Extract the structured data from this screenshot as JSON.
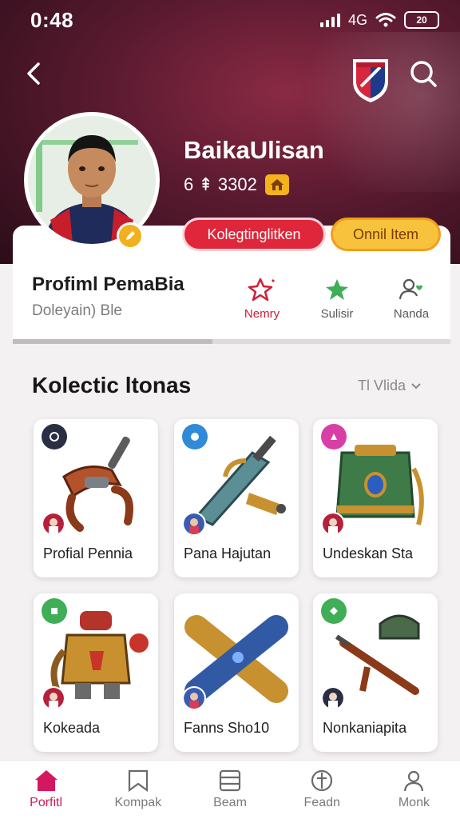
{
  "status_bar": {
    "time": "0:48",
    "network": "4G",
    "battery": "20"
  },
  "header": {
    "username": "BaikaUlisan",
    "stat": "6 ⇞ 3302"
  },
  "actions": {
    "primary_label": "Kolegtinglitken",
    "secondary_label": "Onnil Item"
  },
  "profile_card": {
    "title": "Profiml PemaBia",
    "subtitle": "Doleyain) Ble",
    "quick_actions": [
      {
        "label": "Nemry",
        "icon": "star-outline-icon"
      },
      {
        "label": "Sulisir",
        "icon": "star-icon"
      },
      {
        "label": "Nanda",
        "icon": "user-heart-icon"
      }
    ]
  },
  "collection": {
    "title": "Kolectic ltonas",
    "filter_label": "Tl Vlida",
    "items": [
      {
        "name": "Profial Pennia"
      },
      {
        "name": "Pana Hajutan"
      },
      {
        "name": "Undeskan Sta"
      },
      {
        "name": "Kokeada"
      },
      {
        "name": "Fanns Sho10"
      },
      {
        "name": "Nonkaniapita"
      }
    ]
  },
  "bottom_nav": [
    {
      "label": "Porfitl",
      "icon": "home-icon"
    },
    {
      "label": "Kompak",
      "icon": "bookmark-icon"
    },
    {
      "label": "Beam",
      "icon": "list-icon"
    },
    {
      "label": "Feadn",
      "icon": "compass-icon"
    },
    {
      "label": "Monk",
      "icon": "user-icon"
    }
  ],
  "colors": {
    "accent": "#e0263a",
    "secondary": "#f8c33c",
    "nav_active": "#d4185f",
    "hero_bg": "#5a1a30"
  }
}
